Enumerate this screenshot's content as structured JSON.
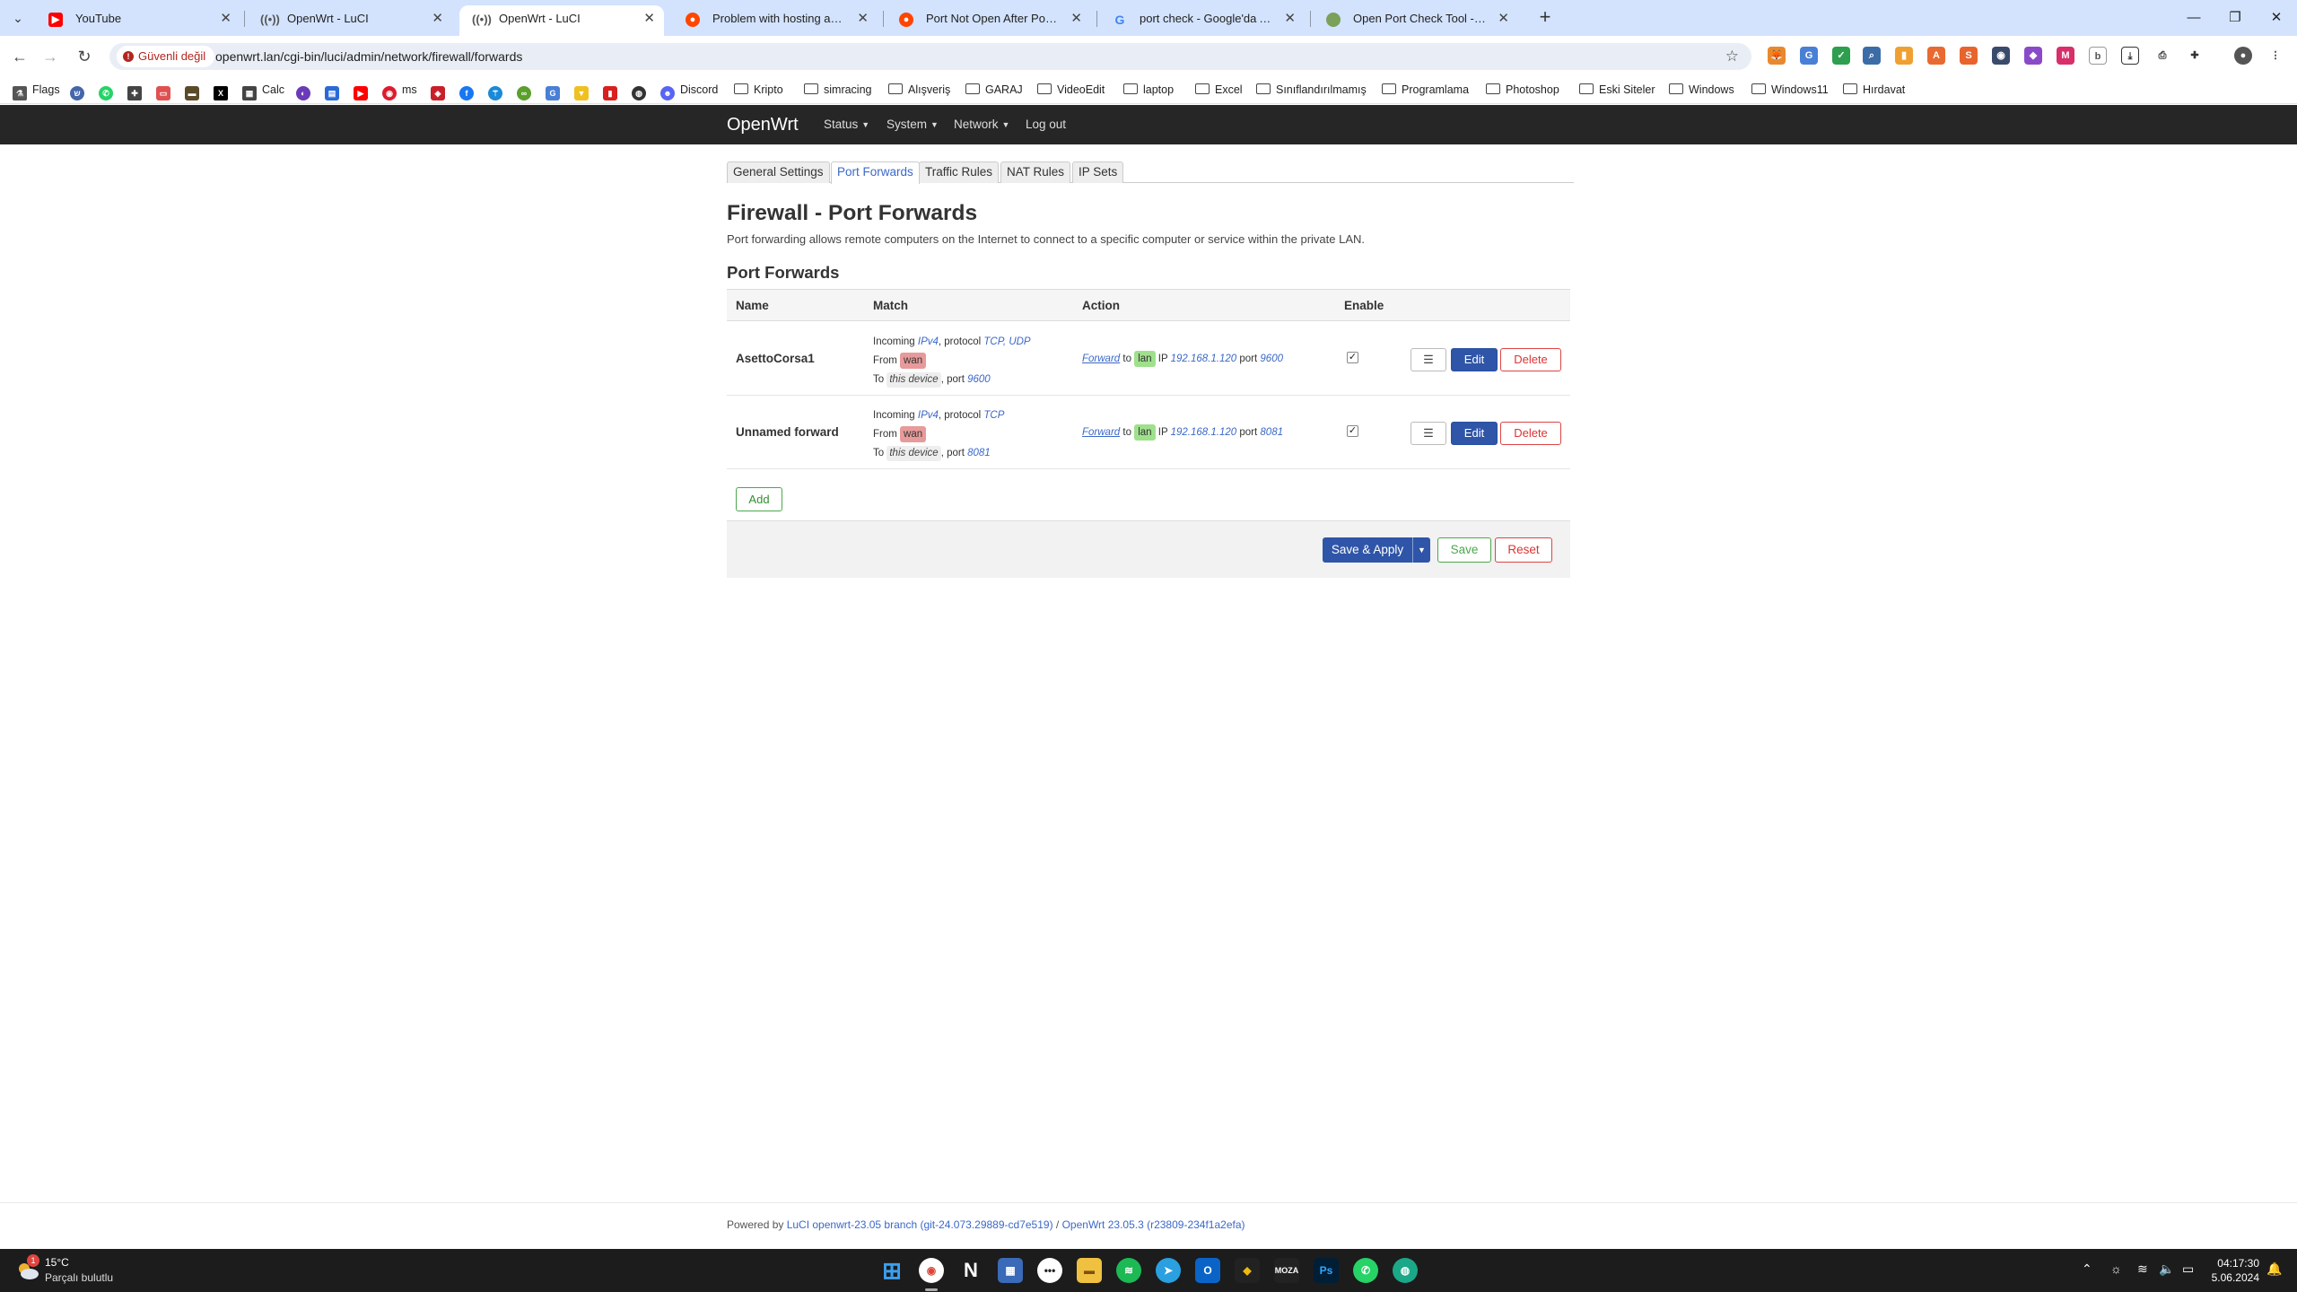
{
  "browser": {
    "tabs": [
      {
        "title": "YouTube",
        "favicon": "youtube-icon",
        "color": "#ff0000"
      },
      {
        "title": "OpenWrt - LuCI",
        "favicon": "wireless-icon",
        "color": "#666666"
      },
      {
        "title": "OpenWrt - LuCI",
        "favicon": "wireless-icon",
        "color": "#666666",
        "active": true
      },
      {
        "title": "Problem with hosting a server",
        "favicon": "reddit-icon",
        "color": "#ff4500"
      },
      {
        "title": "Port Not Open After Port Forw",
        "favicon": "reddit-icon",
        "color": "#ff4500"
      },
      {
        "title": "port check - Google'da Ara",
        "favicon": "google-icon",
        "color": "#4285f4"
      },
      {
        "title": "Open Port Check Tool - Test Po",
        "favicon": "globe-icon",
        "color": "#7aa05a"
      }
    ],
    "security_label": "Güvenli değil",
    "url": "openwrt.lan/cgi-bin/luci/admin/network/firewall/forwards",
    "bookmarks": [
      {
        "label": "Flags",
        "type": "site"
      },
      {
        "label": "Calc",
        "type": "site"
      },
      {
        "label": "ms",
        "type": "site"
      },
      {
        "label": "Discord",
        "type": "site"
      },
      {
        "label": "Kripto",
        "type": "folder"
      },
      {
        "label": "simracing",
        "type": "folder"
      },
      {
        "label": "Alışveriş",
        "type": "folder"
      },
      {
        "label": "GARAJ",
        "type": "folder"
      },
      {
        "label": "VideoEdit",
        "type": "folder"
      },
      {
        "label": "laptop",
        "type": "folder"
      },
      {
        "label": "Excel",
        "type": "folder"
      },
      {
        "label": "Sınıflandırılmamış",
        "type": "folder"
      },
      {
        "label": "Programlama",
        "type": "folder"
      },
      {
        "label": "Photoshop",
        "type": "folder"
      },
      {
        "label": "Eski Siteler",
        "type": "folder"
      },
      {
        "label": "Windows",
        "type": "folder"
      },
      {
        "label": "Windows11",
        "type": "folder"
      },
      {
        "label": "Hırdavat",
        "type": "folder"
      }
    ]
  },
  "luci": {
    "brand": "OpenWrt",
    "nav": [
      "Status",
      "System",
      "Network",
      "Log out"
    ],
    "subtabs": [
      "General Settings",
      "Port Forwards",
      "Traffic Rules",
      "NAT Rules",
      "IP Sets"
    ],
    "page_title": "Firewall - Port Forwards",
    "page_desc": "Port forwarding allows remote computers on the Internet to connect to a specific computer or service within the private LAN.",
    "section_title": "Port Forwards",
    "columns": {
      "name": "Name",
      "match": "Match",
      "action": "Action",
      "enable": "Enable"
    },
    "rows": [
      {
        "name": "AsettoCorsa1",
        "incoming": "Incoming",
        "family": "IPv4",
        "protocol_label": ", protocol",
        "protocols": "TCP, UDP",
        "from_label": "From",
        "from_zone": "wan",
        "to_label": "To",
        "to_device": "this device",
        "port_label": ", port",
        "port": "9600",
        "action_forward": "Forward",
        "action_to": "to",
        "dest_zone": "lan",
        "ip_label": "IP",
        "dest_ip": "192.168.1.120",
        "dest_port_label": "port",
        "dest_port": "9600",
        "enabled": true
      },
      {
        "name": "Unnamed forward",
        "incoming": "Incoming",
        "family": "IPv4",
        "protocol_label": ", protocol",
        "protocols": "TCP",
        "from_label": "From",
        "from_zone": "wan",
        "to_label": "To",
        "to_device": "this device",
        "port_label": ", port",
        "port": "8081",
        "action_forward": "Forward",
        "action_to": "to",
        "dest_zone": "lan",
        "ip_label": "IP",
        "dest_ip": "192.168.1.120",
        "dest_port_label": "port",
        "dest_port": "8081",
        "enabled": true
      }
    ],
    "row_buttons": {
      "menu": "☰",
      "edit": "Edit",
      "delete": "Delete"
    },
    "add_label": "Add",
    "save_apply_label": "Save & Apply",
    "save_label": "Save",
    "reset_label": "Reset",
    "footer_prefix": "Powered by ",
    "footer_luci": "LuCI openwrt-23.05 branch (git-24.073.29889-cd7e519)",
    "footer_sep": " / ",
    "footer_openwrt": "OpenWrt 23.05.3 (r23809-234f1a2efa)"
  },
  "taskbar": {
    "weather_temp": "15°C",
    "weather_desc": "Parçalı bulutlu",
    "weather_badge": "1",
    "time": "04:17:30",
    "date": "5.06.2024"
  }
}
